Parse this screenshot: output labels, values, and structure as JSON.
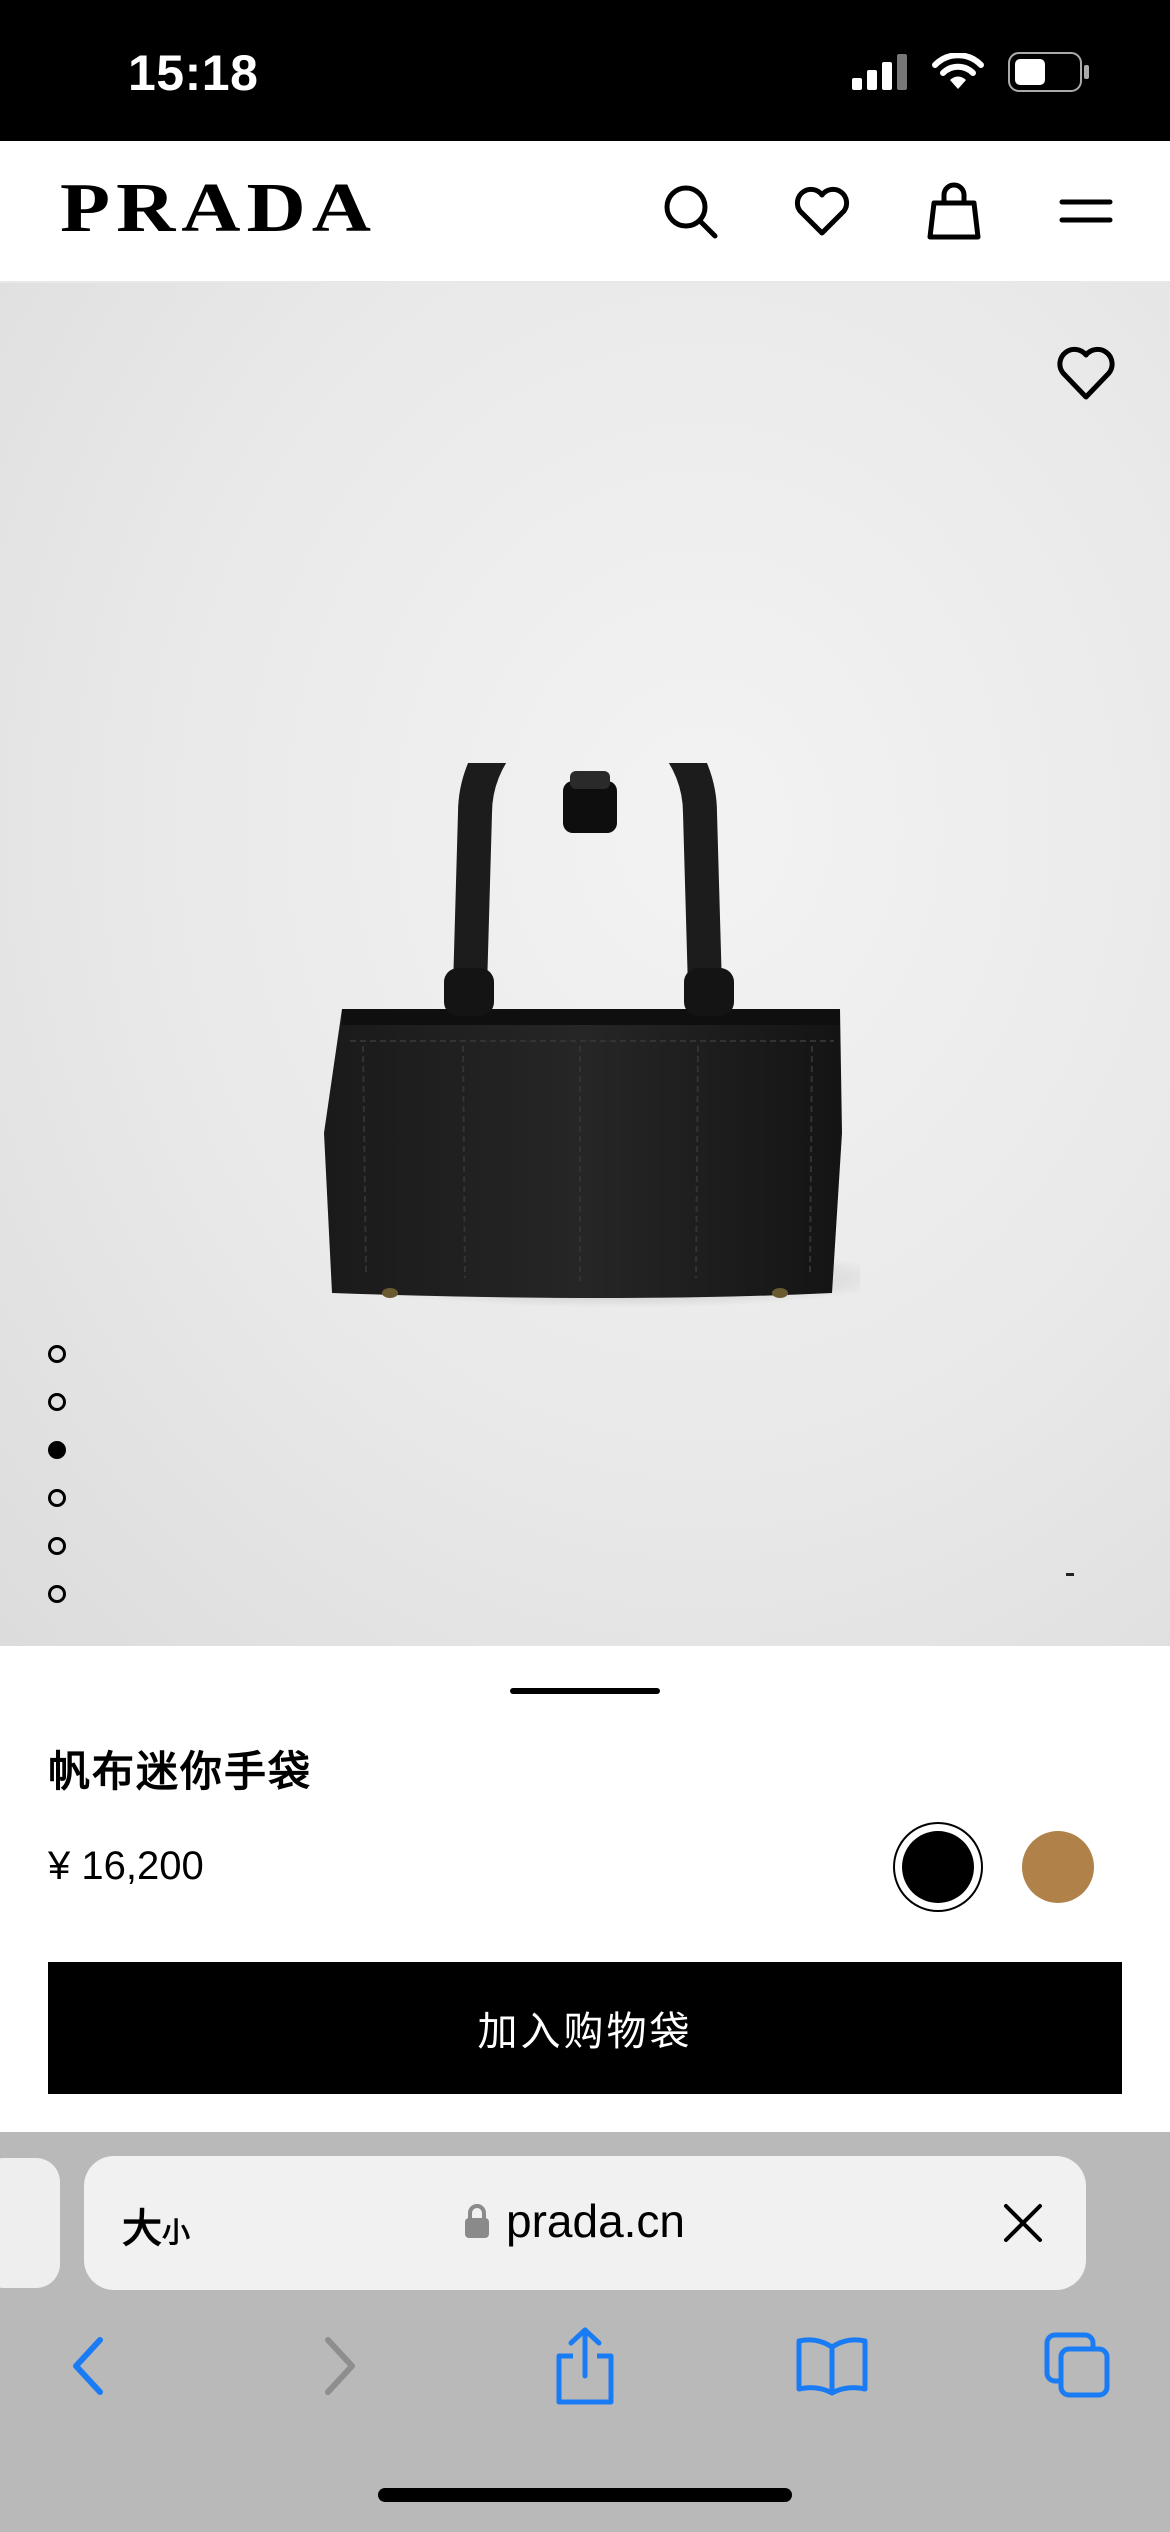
{
  "status_bar": {
    "time": "15:18"
  },
  "header": {
    "logo": "PRADA",
    "icons": [
      "search-icon",
      "heart-icon",
      "shopping-bag-icon",
      "menu-icon"
    ]
  },
  "hero": {
    "image_count": 6,
    "active_index": 2
  },
  "product": {
    "name": "帆布迷你手袋",
    "price": "¥ 16,200",
    "colors": [
      {
        "name": "black",
        "hex": "#000000",
        "selected": true
      },
      {
        "name": "tan",
        "hex": "#b0824a",
        "selected": false
      }
    ],
    "add_to_bag_label": "加入购物袋"
  },
  "browser": {
    "text_size_label_big": "大",
    "text_size_label_small": "小",
    "url": "prada.cn",
    "toolbar_icons": [
      "back-icon",
      "forward-icon",
      "share-icon",
      "bookmarks-icon",
      "tabs-icon"
    ]
  },
  "colors": {
    "accent_blue": "#1a7cf5",
    "black": "#000000",
    "panel_gray": "#b9b9b9"
  }
}
